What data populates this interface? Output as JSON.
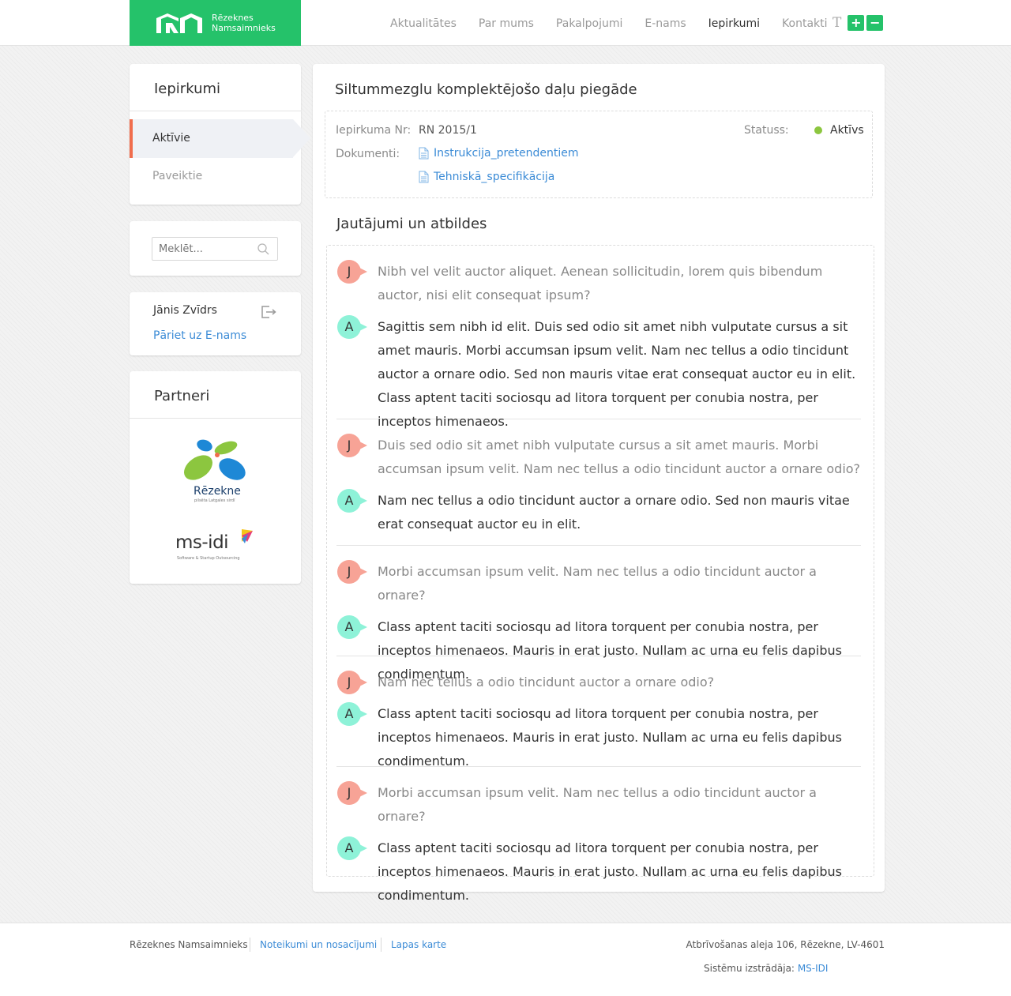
{
  "header": {
    "logo_line1": "Rēzeknes",
    "logo_line2": "Namsaimnieks",
    "nav": [
      "Aktualitātes",
      "Par mums",
      "Pakalpojumi",
      "E-nams",
      "Iepirkumi",
      "Kontakti"
    ],
    "active_nav": "Iepirkumi",
    "font_plus": "+",
    "font_minus": "−",
    "font_toggle": "T",
    "brand_color": "#25c26a"
  },
  "sidebar": {
    "title": "Iepirkumi",
    "menu": [
      {
        "label": "Aktīvie",
        "active": true
      },
      {
        "label": "Paveiktie",
        "active": false
      }
    ],
    "search_placeholder": "Meklēt...",
    "user_name": "Jānis Zvīdrs",
    "user_link": "Pāriet uz E-nams",
    "partners_title": "Partneri",
    "partner1_name": "Rēzekne",
    "partner1_tagline": "pilsēta Latgales sirdī",
    "partner2_name": "ms-idi",
    "partner2_tagline": "Software & Startup Outsourcing"
  },
  "main": {
    "title": "Siltummezglu komplektējošo daļu piegāde",
    "number_label": "Iepirkuma Nr:",
    "number_value": "RN 2015/1",
    "docs_label": "Dokumenti:",
    "docs": [
      "Instrukcija_pretendentiem",
      "Tehniskā_specifikācija"
    ],
    "status_label": "Statuss:",
    "status_value": "Aktīvs",
    "status_color": "#8cc63f",
    "qa_title": "Jautājumi un atbildes",
    "question_badge": "J",
    "answer_badge": "A",
    "qa": [
      {
        "q": "Nibh vel velit auctor aliquet. Aenean sollicitudin, lorem quis bibendum auctor, nisi elit consequat ipsum?",
        "a": "Sagittis sem nibh id elit. Duis sed odio sit amet nibh vulputate cursus a sit amet mauris. Morbi accumsan ipsum velit. Nam nec tellus a odio tincidunt auctor a ornare odio. Sed non  mauris vitae erat consequat auctor eu in elit. Class aptent taciti sociosqu ad litora torquent per conubia nostra, per inceptos himenaeos."
      },
      {
        "q": "Duis sed odio sit amet nibh vulputate cursus a sit amet mauris. Morbi accumsan ipsum velit. Nam nec tellus a odio tincidunt auctor a ornare odio?",
        "a": "Nam nec tellus a odio tincidunt auctor a ornare odio. Sed non  mauris vitae erat consequat auctor eu in elit."
      },
      {
        "q": "Morbi accumsan ipsum velit. Nam nec tellus a odio tincidunt auctor a ornare?",
        "a": "Class aptent taciti sociosqu ad litora torquent per conubia nostra, per inceptos himenaeos. Mauris in erat justo. Nullam ac urna eu felis dapibus condimentum."
      },
      {
        "q": "Nam nec tellus a odio tincidunt auctor a ornare odio?",
        "a": "Class aptent taciti sociosqu ad litora torquent per conubia nostra, per inceptos himenaeos. Mauris in erat justo. Nullam ac urna eu felis dapibus condimentum."
      },
      {
        "q": "Morbi accumsan ipsum velit. Nam nec tellus a odio tincidunt auctor a ornare?",
        "a": "Class aptent taciti sociosqu ad litora torquent per conubia nostra, per inceptos himenaeos. Mauris in erat justo. Nullam ac urna eu felis dapibus condimentum."
      }
    ]
  },
  "footer": {
    "company": "Rēzeknes Namsaimnieks",
    "terms": "Noteikumi un nosacījumi",
    "sitemap": "Lapas karte",
    "address": "Atbrīvošanas aleja 106, Rēzekne, LV-4601",
    "developer_label": "Sistēmu izstrādāja:",
    "developer": "MS-IDI"
  }
}
